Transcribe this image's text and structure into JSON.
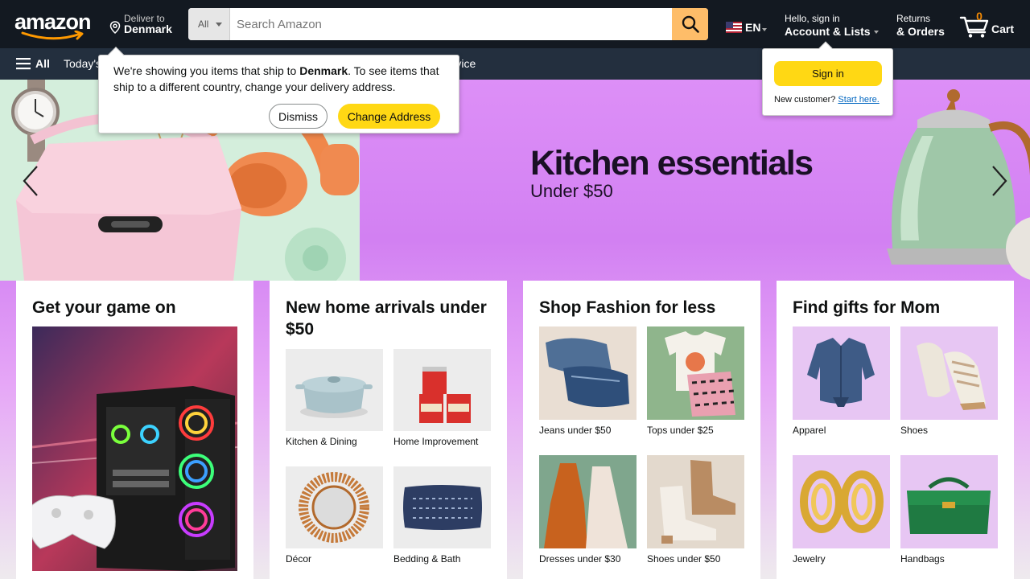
{
  "header": {
    "logo_text": "amazon",
    "deliver_line1": "Deliver to",
    "deliver_line2": "Denmark",
    "search_category": "All",
    "search_placeholder": "Search Amazon",
    "language": "EN",
    "account_line1": "Hello, sign in",
    "account_line2": "Account & Lists",
    "returns_line1": "Returns",
    "returns_line2": "& Orders",
    "cart_count": "0",
    "cart_label": "Cart"
  },
  "subnav": {
    "all_label": "All",
    "links": [
      "Today's Deals",
      "Customer Service"
    ]
  },
  "location_popover": {
    "msg_before": "We're showing you items that ship to ",
    "msg_country": "Denmark",
    "msg_after": ". To see items that ship to a different country, change your delivery address.",
    "dismiss_label": "Dismiss",
    "change_label": "Change Address"
  },
  "signin_popover": {
    "button_label": "Sign in",
    "new_customer": "New customer?",
    "start_here": "Start here."
  },
  "hero": {
    "title": "Kitchen essentials",
    "subtitle": "Under $50"
  },
  "cards": [
    {
      "title": "Get your game on"
    },
    {
      "title": "New home arrivals under $50",
      "tiles": [
        "Kitchen & Dining",
        "Home Improvement",
        "Décor",
        "Bedding & Bath"
      ]
    },
    {
      "title": "Shop Fashion for less",
      "tiles": [
        "Jeans under $50",
        "Tops under $25",
        "Dresses under $30",
        "Shoes under $50"
      ]
    },
    {
      "title": "Find gifts for Mom",
      "tiles": [
        "Apparel",
        "Shoes",
        "Jewelry",
        "Handbags"
      ]
    }
  ],
  "colors": {
    "nav_dark": "#131921",
    "nav_sub": "#232f3e",
    "search_button": "#febd69",
    "button_yellow": "#ffd814",
    "cart_count": "#f08804",
    "hero_purple": "#dd8ff7"
  }
}
